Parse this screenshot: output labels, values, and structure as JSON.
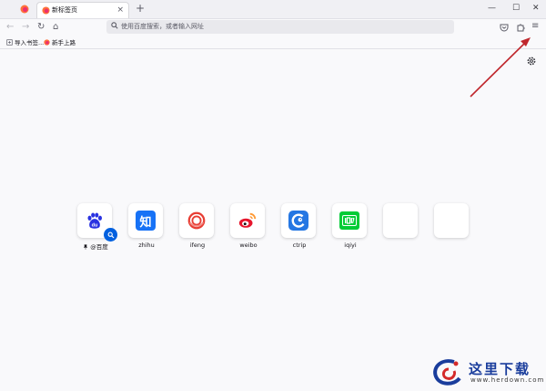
{
  "tabs": {
    "active_title": "新标签页",
    "close_glyph": "×",
    "new_tab_glyph": "+"
  },
  "window_controls": {
    "minimize": "—",
    "maximize": "☐",
    "close": "✕"
  },
  "nav": {
    "back": "←",
    "forward": "→",
    "reload": "↻",
    "home": "⌂",
    "search_placeholder": "使用百度搜索，或者输入网址",
    "menu": "≡"
  },
  "bookmarks": [
    {
      "label": "导入书签..."
    },
    {
      "label": "新手上路"
    }
  ],
  "shortcuts": [
    {
      "label": "@百度",
      "icon": "baidu-icon",
      "pinned": true
    },
    {
      "label": "zhihu",
      "icon": "zhihu-icon"
    },
    {
      "label": "ifeng",
      "icon": "ifeng-icon"
    },
    {
      "label": "weibo",
      "icon": "weibo-icon"
    },
    {
      "label": "ctrip",
      "icon": "ctrip-icon"
    },
    {
      "label": "iqiyi",
      "icon": "iqiyi-icon"
    },
    {
      "label": "",
      "icon": "empty-tile"
    },
    {
      "label": "",
      "icon": "empty-tile"
    }
  ],
  "zhihu_glyph": "知",
  "watermark": {
    "text": "这里下载",
    "url": "www.herdown.com"
  },
  "colors": {
    "accent": "#0060df",
    "annotation_arrow": "#c0272d",
    "zhihu": "#1772f6",
    "iqiyi": "#00cc36",
    "baidu": "#2932e1"
  }
}
